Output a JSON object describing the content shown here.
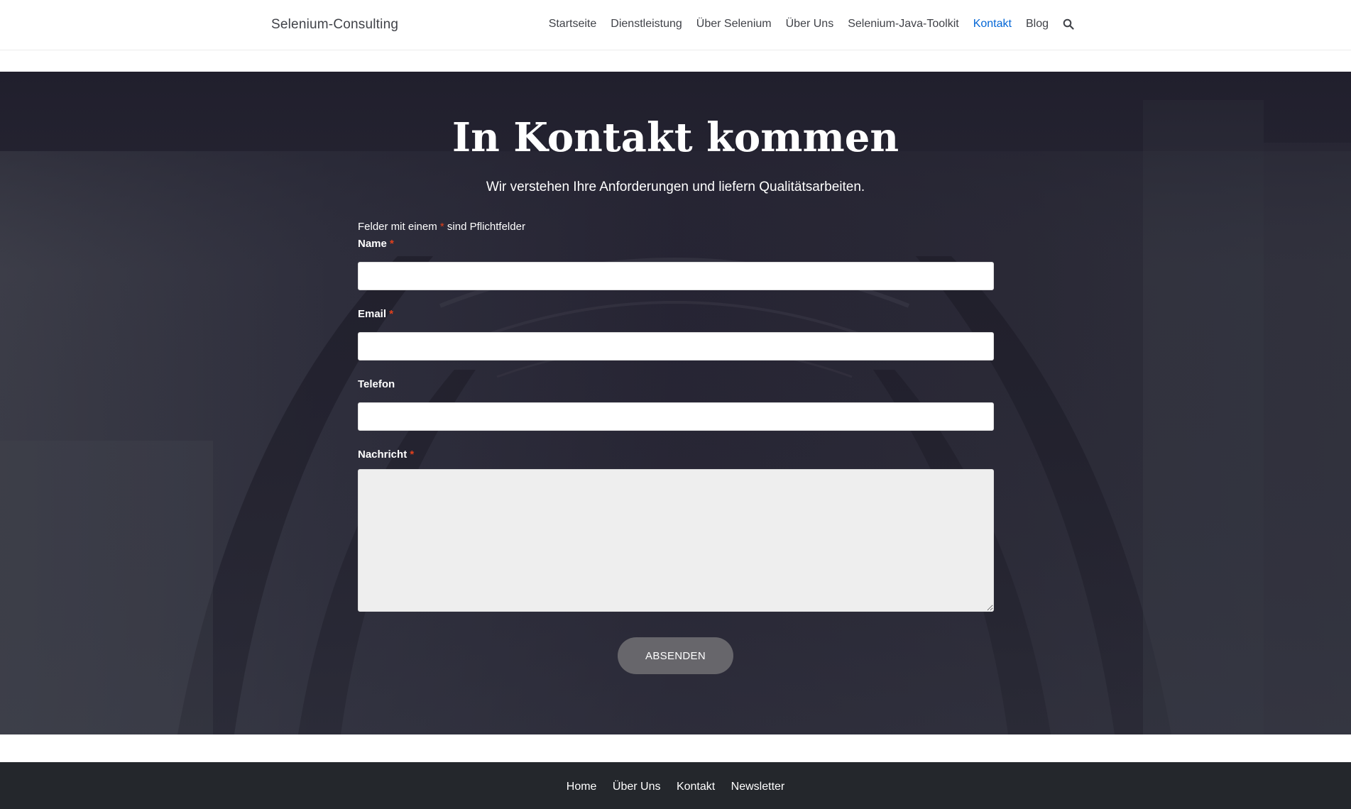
{
  "header": {
    "site_title": "Selenium-Consulting",
    "nav": [
      {
        "label": "Startseite",
        "active": false
      },
      {
        "label": "Dienstleistung",
        "active": false
      },
      {
        "label": "Über Selenium",
        "active": false
      },
      {
        "label": "Über Uns",
        "active": false
      },
      {
        "label": "Selenium-Java-Toolkit",
        "active": false
      },
      {
        "label": "Kontakt",
        "active": true
      },
      {
        "label": "Blog",
        "active": false
      }
    ],
    "search_icon": "search-icon"
  },
  "hero": {
    "title": "In Kontakt kommen",
    "subtitle": "Wir verstehen Ihre Anforderungen und liefern Qualitätsarbeiten."
  },
  "form": {
    "required_note_prefix": "Felder mit einem",
    "required_marker": "*",
    "required_note_suffix": "sind Pflichtfelder",
    "fields": {
      "name": {
        "label": "Name",
        "required": true,
        "value": ""
      },
      "email": {
        "label": "Email",
        "required": true,
        "value": ""
      },
      "phone": {
        "label": "Telefon",
        "required": false,
        "value": ""
      },
      "message": {
        "label": "Nachricht",
        "required": true,
        "value": ""
      }
    },
    "submit_label": "ABSENDEN"
  },
  "footer": {
    "links": [
      "Home",
      "Über Uns",
      "Kontakt",
      "Newsletter"
    ]
  },
  "colors": {
    "accent": "#0366d6",
    "required": "#e2401c",
    "footer_bg": "#24272c",
    "button_bg": "#67666b"
  }
}
